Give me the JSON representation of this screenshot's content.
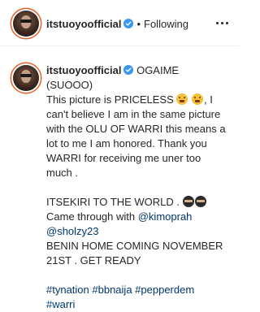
{
  "header": {
    "username": "itstuoyoofficial",
    "separator": "•",
    "follow_state": "Following"
  },
  "comment": {
    "username": "itstuoyoofficial",
    "p1_a": "OGAIME (SUOOO)\nThis picture is PRICELESS ",
    "p1_b": ", I can't believe I am in the same picture with the OLU OF WARRI this means a lot to me I am honored. Thank you WARRI for receiving me uner too much .\n\nITSEKIRI TO THE WORLD . ",
    "p1_c": " Came through with ",
    "mention1": "@kimoprah",
    "mention2": "@sholzy23",
    "p2": "\nBENIN HOME COMING NOVEMBER 21ST . GET READY\n\n",
    "hashtags": [
      "#tynation",
      "#bbnaija",
      "#pepperdem",
      "#warri"
    ]
  },
  "icons": {
    "verified": "verified-badge-icon",
    "more": "more-options-icon",
    "emoji_weary": "weary-face-emoji",
    "emoji_ninja": "ninja-emoji"
  },
  "colors": {
    "text": "#262626",
    "link": "#00376b",
    "verified": "#3897f0",
    "story_ring": "#e2622c"
  }
}
